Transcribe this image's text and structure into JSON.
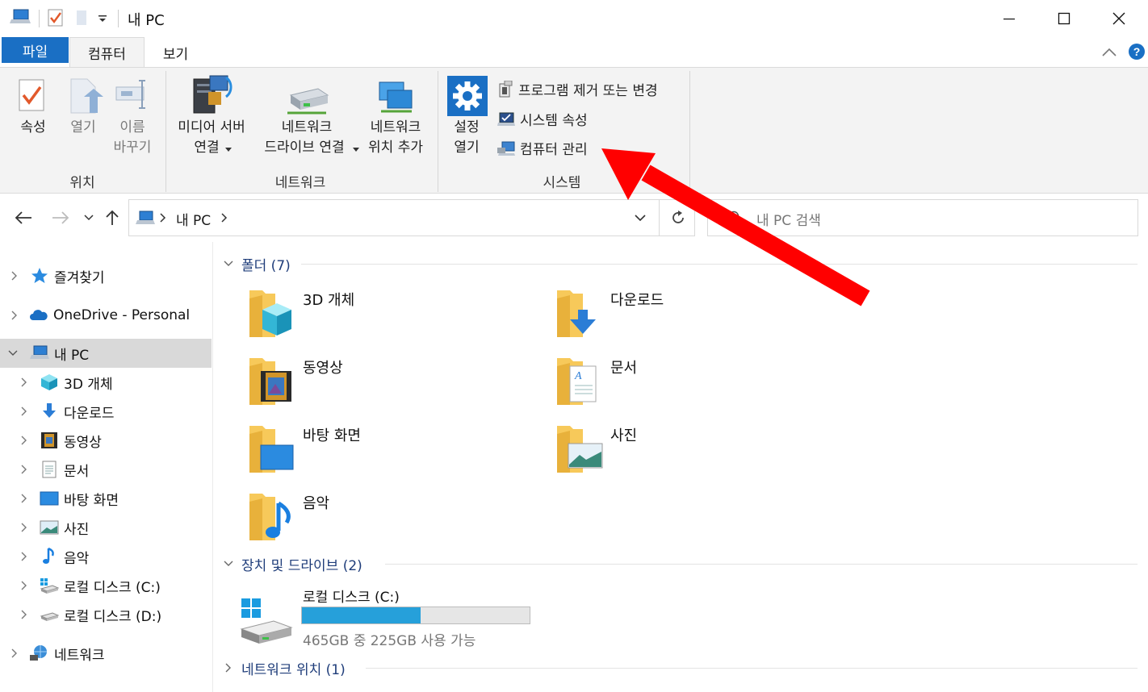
{
  "window": {
    "title": "내 PC",
    "minimize_label": "—",
    "maximize_label": "☐",
    "close_label": "✕"
  },
  "tabs": [
    {
      "label": "파일"
    },
    {
      "label": "컴퓨터"
    },
    {
      "label": "보기"
    }
  ],
  "ribbon": {
    "location_group": {
      "label": "위치",
      "properties": "속성",
      "open": "열기",
      "rename_line1": "이름",
      "rename_line2": "바꾸기"
    },
    "network_group": {
      "label": "네트워크",
      "media_line1": "미디어 서버",
      "media_line2": "연결",
      "map_drive_line1": "네트워크",
      "map_drive_line2": "드라이브 연결",
      "add_location_line1": "네트워크",
      "add_location_line2": "위치 추가"
    },
    "system_group": {
      "label": "시스템",
      "settings_line1": "설정",
      "settings_line2": "열기",
      "uninstall": "프로그램 제거 또는 변경",
      "system_properties": "시스템 속성",
      "manage": "컴퓨터 관리"
    }
  },
  "address": {
    "crumb": "내 PC",
    "search_placeholder": "내 PC 검색"
  },
  "sidebar": {
    "quick_access": "즐겨찾기",
    "onedrive": "OneDrive - Personal",
    "this_pc": "내 PC",
    "children": [
      {
        "label": "3D 개체"
      },
      {
        "label": "다운로드"
      },
      {
        "label": "동영상"
      },
      {
        "label": "문서"
      },
      {
        "label": "바탕 화면"
      },
      {
        "label": "사진"
      },
      {
        "label": "음악"
      },
      {
        "label": "로컬 디스크 (C:)"
      },
      {
        "label": "로컬 디스크 (D:)"
      }
    ],
    "network": "네트워크"
  },
  "content": {
    "folders_header": "폴더 (7)",
    "folders": [
      {
        "label": "3D 개체",
        "icon": "3d-objects-icon"
      },
      {
        "label": "다운로드",
        "icon": "download-icon"
      },
      {
        "label": "동영상",
        "icon": "video-icon"
      },
      {
        "label": "문서",
        "icon": "document-icon"
      },
      {
        "label": "바탕 화면",
        "icon": "desktop-icon"
      },
      {
        "label": "사진",
        "icon": "pictures-icon"
      },
      {
        "label": "음악",
        "icon": "music-icon"
      }
    ],
    "devices_header": "장치 및 드라이브 (2)",
    "drive": {
      "label": "로컬 디스크 (C:)",
      "free_text": "465GB 중 225GB 사용 가능",
      "used_fraction": 0.52
    },
    "network_header": "네트워크 위치 (1)"
  },
  "colors": {
    "accent": "#1a6fc4",
    "drive_bar": "#26a0da",
    "annotation_arrow": "#ff0000"
  }
}
